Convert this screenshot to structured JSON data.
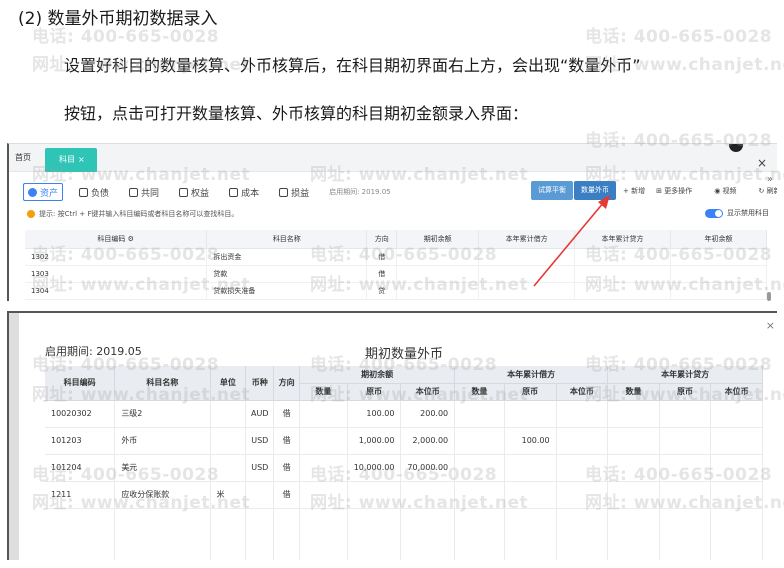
{
  "document": {
    "heading": "(2) 数量外币期初数据录入",
    "para1": "设置好科目的数量核算、外币核算后，在科目期初界面右上方，会出现“数量外币”",
    "para2": "按钮，点击可打开数量核算、外币核算的科目期初金额录入界面："
  },
  "watermark": {
    "phone": "电话: 400-665-0028",
    "site": "网址: www.chanjet.net"
  },
  "screen1": {
    "tabs": {
      "home": "首页",
      "active": "科目",
      "close": "×"
    },
    "close": "×",
    "collapse": "»",
    "categories": [
      "资产",
      "负债",
      "共同",
      "权益",
      "成本",
      "损益"
    ],
    "period_label": "启用期间: 2019.05",
    "buttons": {
      "trial_balance": "试算平衡",
      "qty_currency": "数量外币"
    },
    "actions": {
      "add": "+ 新增",
      "more": "更多操作",
      "video": "视频",
      "refresh": "刷新"
    },
    "tip": "提示: 按Ctrl + F键并输入科目编码或者科目名称可以查找科目。",
    "toggle_label": "显示禁用科目",
    "columns": [
      "科目编码",
      "科目名称",
      "方向",
      "期初余额",
      "本年累计借方",
      "本年累计贷方",
      "年初余额"
    ],
    "rows": [
      {
        "code": "1302",
        "name": "拆出资金",
        "dir": "借"
      },
      {
        "code": "1303",
        "name": "贷款",
        "dir": "借"
      },
      {
        "code": "1304",
        "name": "贷款损失准备",
        "dir": "贷"
      }
    ]
  },
  "screen2": {
    "close": "×",
    "period_label": "启用期间: 2019.05",
    "title": "期初数量外币",
    "group_headers": {
      "opening": "期初余额",
      "debit": "本年累计借方",
      "credit": "本年累计贷方"
    },
    "columns": {
      "code": "科目编码",
      "name": "科目名称",
      "unit": "单位",
      "currency": "币种",
      "dir": "方向",
      "qty": "数量",
      "orig": "原币",
      "local": "本位币"
    },
    "rows": [
      {
        "code": "10020302",
        "name": "三级2",
        "unit": "",
        "currency": "AUD",
        "dir": "借",
        "op_qty": "",
        "op_orig": "100.00",
        "op_local": "200.00",
        "dr_qty": "",
        "dr_orig": "",
        "dr_local": "",
        "cr_qty": "",
        "cr_orig": "",
        "cr_local": ""
      },
      {
        "code": "101203",
        "name": "外币",
        "unit": "",
        "currency": "USD",
        "dir": "借",
        "op_qty": "",
        "op_orig": "1,000.00",
        "op_local": "2,000.00",
        "dr_qty": "",
        "dr_orig": "100.00",
        "dr_local": "",
        "cr_qty": "",
        "cr_orig": "",
        "cr_local": ""
      },
      {
        "code": "101204",
        "name": "美元",
        "unit": "",
        "currency": "USD",
        "dir": "借",
        "op_qty": "",
        "op_orig": "10,000.00",
        "op_local": "70,000.00",
        "dr_qty": "",
        "dr_orig": "",
        "dr_local": "",
        "cr_qty": "",
        "cr_orig": "",
        "cr_local": ""
      },
      {
        "code": "1211",
        "name": "应收分保账款",
        "unit": "米",
        "currency": "",
        "dir": "借",
        "op_qty": "",
        "op_orig": "",
        "op_local": "",
        "dr_qty": "",
        "dr_orig": "",
        "dr_local": "",
        "cr_qty": "",
        "cr_orig": "",
        "cr_local": ""
      }
    ]
  },
  "colors": {
    "accent": "#3a7fc4",
    "tab_active": "#2ec4b6",
    "arrow": "#e53935"
  }
}
